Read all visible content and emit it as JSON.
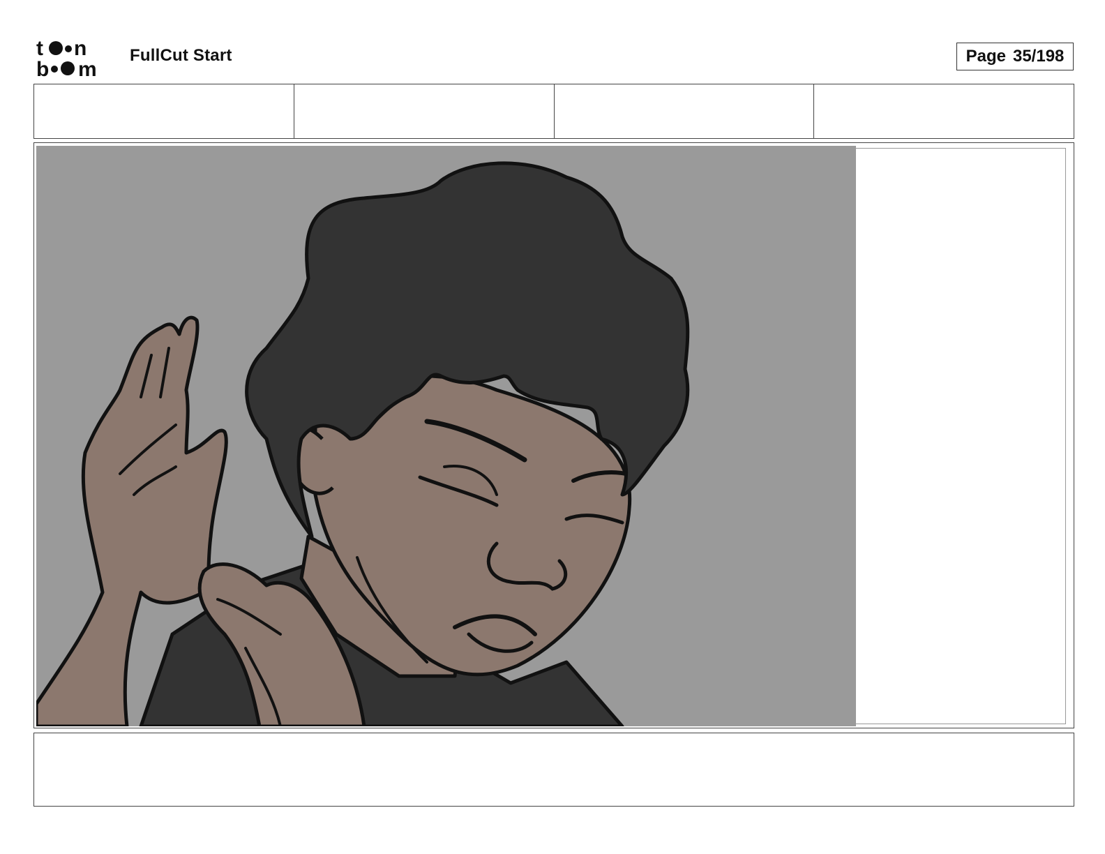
{
  "header": {
    "logo_text_top": "toon",
    "logo_text_bottom": "boom",
    "project_title": "FullCut Start",
    "page_label": "Page",
    "page_number": "35/198"
  },
  "fields": [
    "",
    "",
    "",
    ""
  ],
  "panel": {
    "background_color": "#9a9a9a",
    "hair_color": "#333333",
    "skin_color": "#8c786e",
    "shirt_color": "#333333",
    "line_color": "#111111"
  },
  "caption": ""
}
